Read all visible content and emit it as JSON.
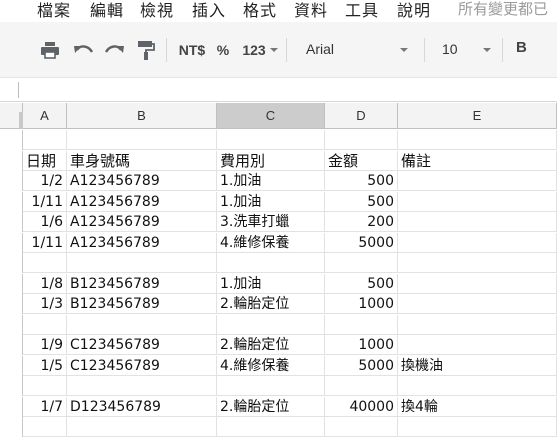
{
  "menu": {
    "items": [
      "檔案",
      "編輯",
      "檢視",
      "插入",
      "格式",
      "資料",
      "工具",
      "說明"
    ],
    "status": "所有變更都已"
  },
  "toolbar": {
    "print_icon": "print-icon",
    "undo_icon": "undo-icon",
    "redo_icon": "redo-icon",
    "paint_icon": "paint-format-icon",
    "currency": "NT$",
    "percent": "%",
    "more_formats": "123",
    "font": "Arial",
    "font_size": "10",
    "bold": "B"
  },
  "columns": [
    "A",
    "B",
    "C",
    "D",
    "E"
  ],
  "rows": [
    [
      "",
      "",
      "",
      "",
      ""
    ],
    [
      "日期",
      "車身號碼",
      "費用別",
      "金額",
      "備註"
    ],
    [
      "1/2",
      "A123456789",
      "1.加油",
      "500",
      ""
    ],
    [
      "1/11",
      "A123456789",
      "1.加油",
      "500",
      ""
    ],
    [
      "1/6",
      "A123456789",
      "3.洗車打蠟",
      "200",
      ""
    ],
    [
      "1/11",
      "A123456789",
      "4.維修保養",
      "5000",
      ""
    ],
    [
      "",
      "",
      "",
      "",
      ""
    ],
    [
      "1/8",
      "B123456789",
      "1.加油",
      "500",
      ""
    ],
    [
      "1/3",
      "B123456789",
      "2.輪胎定位",
      "1000",
      ""
    ],
    [
      "",
      "",
      "",
      "",
      ""
    ],
    [
      "1/9",
      "C123456789",
      "2.輪胎定位",
      "1000",
      ""
    ],
    [
      "1/5",
      "C123456789",
      "4.維修保養",
      "5000",
      "換機油"
    ],
    [
      "",
      "",
      "",
      "",
      ""
    ],
    [
      "1/7",
      "D123456789",
      "2.輪胎定位",
      "40000",
      "換4輪"
    ],
    [
      "",
      "",
      "",
      "",
      ""
    ]
  ]
}
